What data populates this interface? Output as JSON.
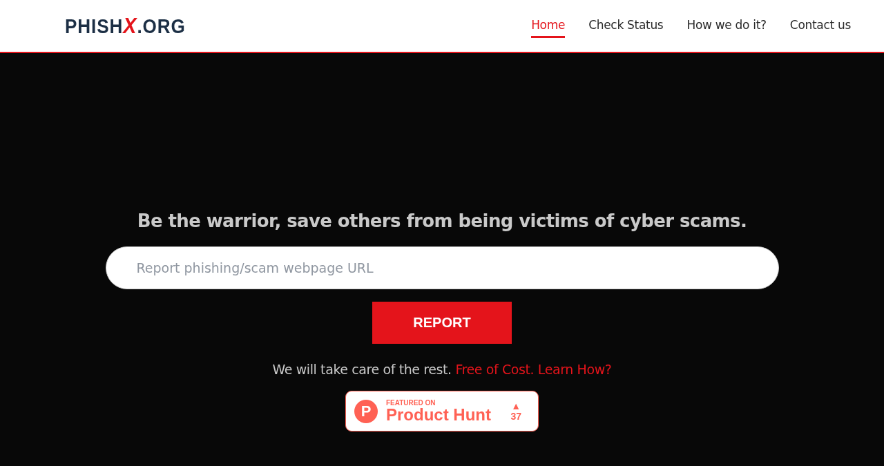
{
  "logo": {
    "name": "PHISH",
    "mark": "X",
    "suffix": ".ORG"
  },
  "nav": [
    {
      "label": "Home",
      "selected": true
    },
    {
      "label": "Check Status",
      "selected": false
    },
    {
      "label": "How we do it?",
      "selected": false
    },
    {
      "label": "Contact us",
      "selected": false
    }
  ],
  "hero": {
    "heading": "Be the warrior, save others from being victims of cyber scams.",
    "placeholder": "Report phishing/scam webpage URL",
    "button": "REPORT",
    "note": "We will take care of the rest.",
    "link": "Free of Cost. Learn How?"
  },
  "badge": {
    "caption": "FEATURED ON",
    "title": "Product Hunt",
    "letter": "P",
    "arrow": "▲",
    "count": "37"
  }
}
